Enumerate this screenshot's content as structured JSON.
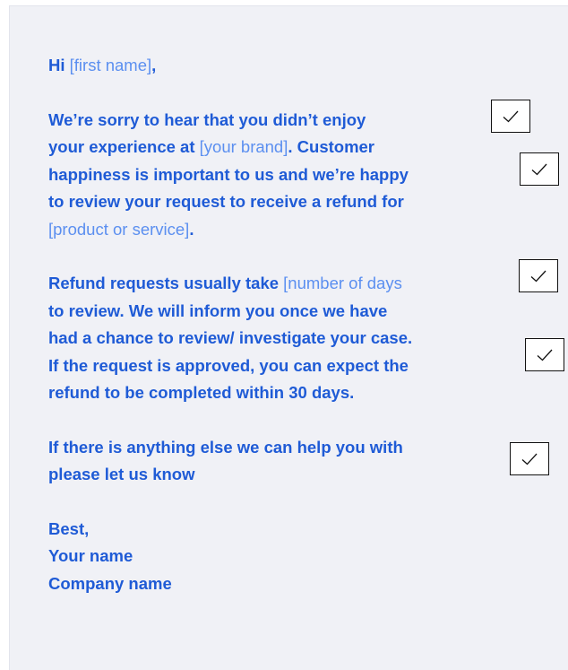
{
  "greeting": {
    "hi": "Hi",
    "name_placeholder": "[first name]",
    "comma": ","
  },
  "paragraph1": {
    "line1": "We’re sorry to hear that you didn’t enjoy",
    "line2_a": "your experience at ",
    "line2_placeholder": "[your brand]",
    "line2_b": ". Customer",
    "line3": "happiness is important to us and we’re happy",
    "line4": "to review your request to receive a refund for",
    "line5_placeholder": "[product or service]",
    "line5_b": "."
  },
  "paragraph2": {
    "line1_a": "Refund requests usually take ",
    "line1_placeholder": "[number of days",
    "line2": "to review. We will inform you once we have",
    "line3": "had a chance to review/ investigate your case.",
    "line4": "If the request is approved, you can expect the",
    "line5": "refund to be completed within 30 days."
  },
  "paragraph3": {
    "line1": "If there is anything else we can help you with",
    "line2": "please let us know"
  },
  "signature": {
    "closing": "Best,",
    "name": "Your name",
    "company": "Company name"
  },
  "checkmarks": [
    "checkmark-icon",
    "checkmark-icon",
    "checkmark-icon",
    "checkmark-icon",
    "checkmark-icon"
  ],
  "colors": {
    "text": "#1f5bd6",
    "placeholder": "#5b8ff0",
    "background": "#f0f1f6"
  }
}
